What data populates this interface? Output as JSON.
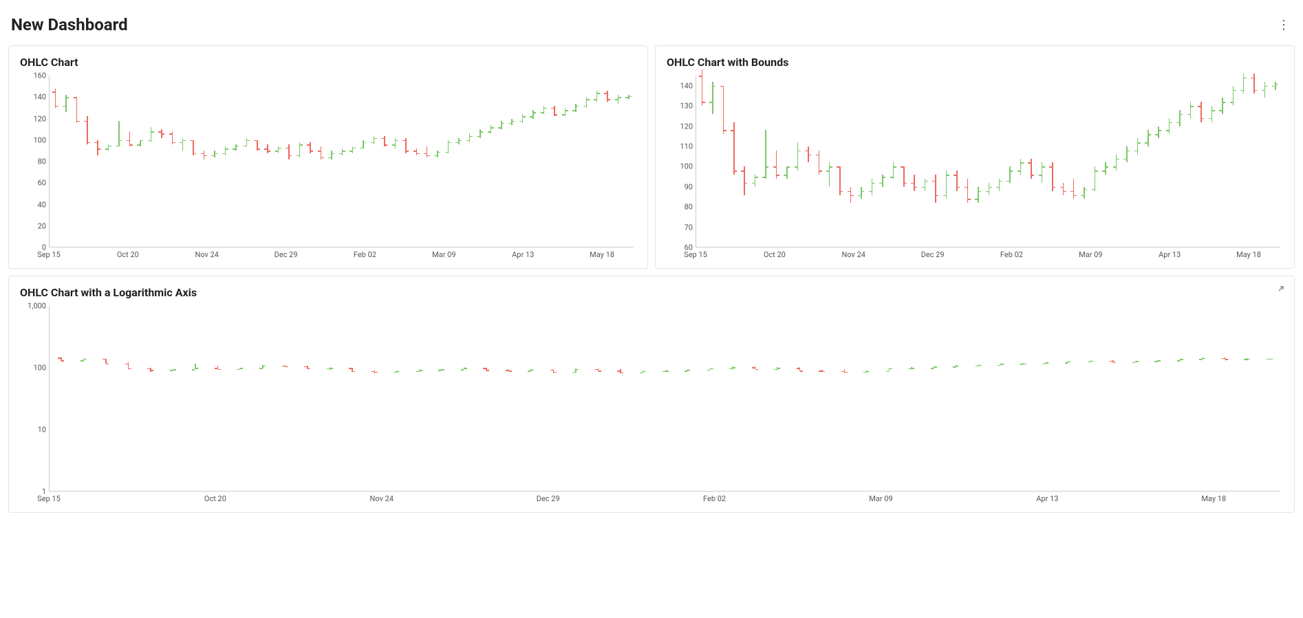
{
  "header": {
    "title": "New Dashboard"
  },
  "panels": [
    {
      "id": "p1",
      "title": "OHLC Chart"
    },
    {
      "id": "p2",
      "title": "OHLC Chart with Bounds"
    },
    {
      "id": "p3",
      "title": "OHLC Chart with a Logarithmic Axis"
    }
  ],
  "chart_data": [
    {
      "type": "ohlc",
      "title": "OHLC Chart",
      "x_labels": [
        "Sep 15",
        "Oct 20",
        "Nov 24",
        "Dec 29",
        "Feb 02",
        "Mar 09",
        "Apr 13",
        "May 18"
      ],
      "y_ticks": [
        0,
        20,
        40,
        60,
        80,
        100,
        120,
        140,
        160
      ],
      "ylim": [
        0,
        160
      ],
      "series": [
        {
          "o": 145,
          "h": 148,
          "l": 130,
          "c": 132
        },
        {
          "o": 132,
          "h": 142,
          "l": 126,
          "c": 140
        },
        {
          "o": 140,
          "h": 140,
          "l": 116,
          "c": 118
        },
        {
          "o": 118,
          "h": 122,
          "l": 96,
          "c": 98
        },
        {
          "o": 98,
          "h": 100,
          "l": 86,
          "c": 92
        },
        {
          "o": 92,
          "h": 96,
          "l": 90,
          "c": 95
        },
        {
          "o": 95,
          "h": 118,
          "l": 94,
          "c": 100
        },
        {
          "o": 100,
          "h": 108,
          "l": 94,
          "c": 96
        },
        {
          "o": 96,
          "h": 100,
          "l": 94,
          "c": 100
        },
        {
          "o": 100,
          "h": 112,
          "l": 98,
          "c": 108
        },
        {
          "o": 108,
          "h": 110,
          "l": 102,
          "c": 106
        },
        {
          "o": 106,
          "h": 108,
          "l": 96,
          "c": 98
        },
        {
          "o": 98,
          "h": 102,
          "l": 90,
          "c": 100
        },
        {
          "o": 100,
          "h": 100,
          "l": 86,
          "c": 88
        },
        {
          "o": 88,
          "h": 90,
          "l": 82,
          "c": 86
        },
        {
          "o": 86,
          "h": 90,
          "l": 84,
          "c": 88
        },
        {
          "o": 88,
          "h": 94,
          "l": 86,
          "c": 92
        },
        {
          "o": 92,
          "h": 96,
          "l": 90,
          "c": 95
        },
        {
          "o": 95,
          "h": 102,
          "l": 94,
          "c": 100
        },
        {
          "o": 100,
          "h": 100,
          "l": 90,
          "c": 92
        },
        {
          "o": 92,
          "h": 96,
          "l": 88,
          "c": 90
        },
        {
          "o": 90,
          "h": 94,
          "l": 88,
          "c": 93
        },
        {
          "o": 93,
          "h": 96,
          "l": 82,
          "c": 86
        },
        {
          "o": 86,
          "h": 98,
          "l": 84,
          "c": 96
        },
        {
          "o": 96,
          "h": 98,
          "l": 88,
          "c": 90
        },
        {
          "o": 90,
          "h": 94,
          "l": 82,
          "c": 84
        },
        {
          "o": 84,
          "h": 90,
          "l": 82,
          "c": 88
        },
        {
          "o": 88,
          "h": 92,
          "l": 86,
          "c": 90
        },
        {
          "o": 90,
          "h": 94,
          "l": 88,
          "c": 93
        },
        {
          "o": 93,
          "h": 100,
          "l": 92,
          "c": 98
        },
        {
          "o": 98,
          "h": 104,
          "l": 96,
          "c": 102
        },
        {
          "o": 102,
          "h": 104,
          "l": 94,
          "c": 96
        },
        {
          "o": 96,
          "h": 102,
          "l": 92,
          "c": 100
        },
        {
          "o": 100,
          "h": 102,
          "l": 88,
          "c": 90
        },
        {
          "o": 90,
          "h": 92,
          "l": 86,
          "c": 88
        },
        {
          "o": 88,
          "h": 94,
          "l": 84,
          "c": 86
        },
        {
          "o": 86,
          "h": 90,
          "l": 84,
          "c": 89
        },
        {
          "o": 89,
          "h": 100,
          "l": 88,
          "c": 98
        },
        {
          "o": 98,
          "h": 102,
          "l": 96,
          "c": 100
        },
        {
          "o": 100,
          "h": 106,
          "l": 98,
          "c": 104
        },
        {
          "o": 104,
          "h": 110,
          "l": 102,
          "c": 108
        },
        {
          "o": 108,
          "h": 114,
          "l": 106,
          "c": 112
        },
        {
          "o": 112,
          "h": 118,
          "l": 110,
          "c": 116
        },
        {
          "o": 116,
          "h": 120,
          "l": 114,
          "c": 118
        },
        {
          "o": 118,
          "h": 124,
          "l": 116,
          "c": 122
        },
        {
          "o": 122,
          "h": 128,
          "l": 120,
          "c": 126
        },
        {
          "o": 126,
          "h": 132,
          "l": 124,
          "c": 130
        },
        {
          "o": 130,
          "h": 132,
          "l": 122,
          "c": 124
        },
        {
          "o": 124,
          "h": 130,
          "l": 122,
          "c": 128
        },
        {
          "o": 128,
          "h": 134,
          "l": 126,
          "c": 132
        },
        {
          "o": 132,
          "h": 140,
          "l": 130,
          "c": 138
        },
        {
          "o": 138,
          "h": 146,
          "l": 136,
          "c": 144
        },
        {
          "o": 144,
          "h": 146,
          "l": 136,
          "c": 138
        },
        {
          "o": 138,
          "h": 142,
          "l": 134,
          "c": 140
        },
        {
          "o": 140,
          "h": 142,
          "l": 138,
          "c": 141
        }
      ]
    },
    {
      "type": "ohlc",
      "title": "OHLC Chart with Bounds",
      "x_labels": [
        "Sep 15",
        "Oct 20",
        "Nov 24",
        "Dec 29",
        "Feb 02",
        "Mar 09",
        "Apr 13",
        "May 18"
      ],
      "y_ticks": [
        60,
        70,
        80,
        90,
        100,
        110,
        120,
        130,
        140
      ],
      "ylim": [
        60,
        145
      ],
      "series": "same_as_0"
    },
    {
      "type": "ohlc",
      "title": "OHLC Chart with a Logarithmic Axis",
      "x_labels": [
        "Sep 15",
        "Oct 20",
        "Nov 24",
        "Dec 29",
        "Feb 02",
        "Mar 09",
        "Apr 13",
        "May 18"
      ],
      "y_ticks": [
        1,
        10,
        100,
        1000
      ],
      "y_tick_labels": [
        "1",
        "10",
        "100",
        "1,000"
      ],
      "scale": "log",
      "ylim": [
        1,
        1000
      ],
      "series": "same_as_0"
    }
  ]
}
